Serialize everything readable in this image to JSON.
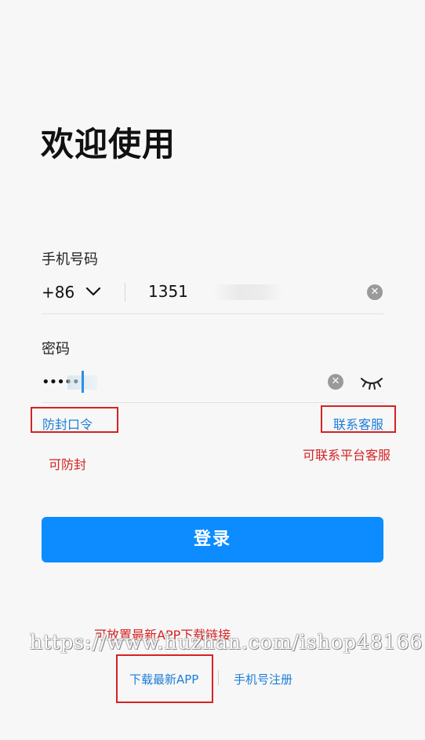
{
  "page": {
    "title": "欢迎使用"
  },
  "phone": {
    "label": "手机号码",
    "country_code": "+86",
    "value": "1351",
    "clear_icon": "clear-circle-icon"
  },
  "password": {
    "label": "密码",
    "value": "•••••",
    "clear_icon": "clear-circle-icon",
    "visibility_icon": "eye-closed-icon"
  },
  "links": {
    "anti_block": "防封口令",
    "contact_service": "联系客服"
  },
  "annotations": {
    "anti_block_note": "可防封",
    "contact_note": "可联系平台客服",
    "download_note": "可放置最新APP下载链接"
  },
  "login_button": "登录",
  "watermark": "https://www.huzhan.com/ishop48166",
  "footer": {
    "download_app": "下载最新APP",
    "register": "手机号注册"
  },
  "colors": {
    "accent": "#0c8cff",
    "link": "#1c7ed8",
    "annotation": "#d62222"
  }
}
